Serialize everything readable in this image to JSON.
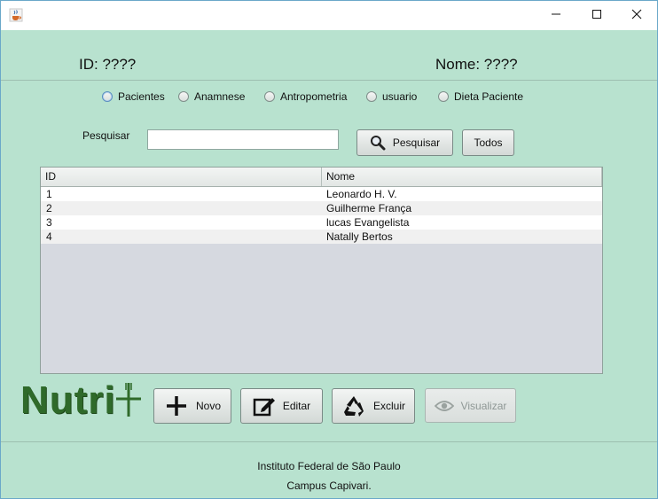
{
  "window": {
    "app_icon": "java-cup-icon",
    "controls": [
      "minimize-icon",
      "maximize-icon",
      "close-icon"
    ]
  },
  "header": {
    "id_label": "ID:  ????",
    "nome_label": "Nome: ????"
  },
  "radios": [
    {
      "label": "Pacientes",
      "selected": true
    },
    {
      "label": "Anamnese",
      "selected": false
    },
    {
      "label": "Antropometria",
      "selected": false
    },
    {
      "label": "usuario",
      "selected": false
    },
    {
      "label": "Dieta Paciente",
      "selected": false
    }
  ],
  "search": {
    "label": "Pesquisar",
    "value": "",
    "button_label": "Pesquisar",
    "button_icon": "magnifier-icon",
    "all_label": "Todos"
  },
  "table": {
    "columns": [
      "ID",
      "Nome"
    ],
    "rows": [
      [
        "1",
        "Leonardo H. V."
      ],
      [
        "2",
        "Guilherme França"
      ],
      [
        "3",
        "lucas Evangelista"
      ],
      [
        "4",
        "Natally Bertos"
      ]
    ]
  },
  "logo": {
    "text": "Nutri",
    "icon": "fork-knife-icon"
  },
  "actions": [
    {
      "label": "Novo",
      "icon": "plus-icon",
      "enabled": true
    },
    {
      "label": "Editar",
      "icon": "edit-icon",
      "enabled": true
    },
    {
      "label": "Excluir",
      "icon": "recycle-icon",
      "enabled": true
    },
    {
      "label": "Visualizar",
      "icon": "eye-icon",
      "enabled": false
    }
  ],
  "footer": {
    "line1": "Instituto Federal de São Paulo",
    "line2": "Campus Capivari."
  },
  "colors": {
    "background": "#b8e2cf",
    "logo_green": "#2f6a2a"
  }
}
